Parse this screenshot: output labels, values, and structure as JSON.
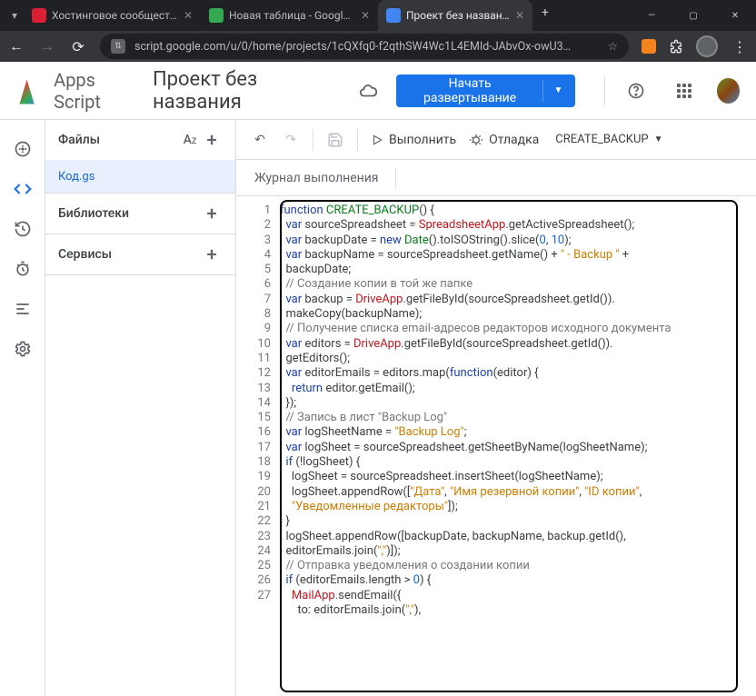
{
  "browser": {
    "tabs": [
      {
        "title": "Хостинговое сообщество",
        "favColor": "#db1f35"
      },
      {
        "title": "Новая таблица - Google Т",
        "favColor": "#34a853"
      },
      {
        "title": "Проект без названия - Ре",
        "favColor": "#4285f4"
      }
    ],
    "url": "script.google.com/u/0/home/projects/1cQXfq0-f2qthSW4Wc1L4EMId-JAbvOx-owU3…"
  },
  "header": {
    "appName": "Apps Script",
    "projectName": "Проект без названия",
    "deployLabel": "Начать развертывание"
  },
  "sidebar": {
    "files": {
      "label": "Файлы",
      "items": [
        "Код.gs"
      ]
    },
    "libraries": {
      "label": "Библиотеки"
    },
    "services": {
      "label": "Сервисы"
    }
  },
  "toolbar": {
    "runLabel": "Выполнить",
    "debugLabel": "Отладка",
    "fnName": "CREATE_BACKUP",
    "logLabel": "Журнал выполнения"
  },
  "code": {
    "lineNumbers": [
      "1",
      "2",
      "3",
      "4",
      "",
      "5",
      "6",
      "7",
      "",
      "8",
      "9",
      "10",
      "",
      "11",
      "12",
      "13",
      "14",
      "15",
      "16",
      "17",
      "18",
      "19",
      "20",
      "",
      "21",
      "22",
      "",
      "23",
      "24",
      "25",
      "26",
      "27"
    ],
    "lines": [
      [
        {
          "c": "kw",
          "t": "function"
        },
        {
          "c": "pun",
          "t": " "
        },
        {
          "c": "fn",
          "t": "CREATE_BACKUP"
        },
        {
          "c": "pun",
          "t": "() {"
        }
      ],
      [
        {
          "c": "pun",
          "t": "  "
        },
        {
          "c": "kw",
          "t": "var"
        },
        {
          "c": "pun",
          "t": " sourceSpreadsheet = "
        },
        {
          "c": "cls",
          "t": "SpreadsheetApp"
        },
        {
          "c": "pun",
          "t": ".getActiveSpreadsheet();"
        }
      ],
      [
        {
          "c": "pun",
          "t": "  "
        },
        {
          "c": "kw",
          "t": "var"
        },
        {
          "c": "pun",
          "t": " backupDate = "
        },
        {
          "c": "kw",
          "t": "new"
        },
        {
          "c": "pun",
          "t": " "
        },
        {
          "c": "fn",
          "t": "Date"
        },
        {
          "c": "pun",
          "t": "().toISOString().slice("
        },
        {
          "c": "num",
          "t": "0"
        },
        {
          "c": "pun",
          "t": ", "
        },
        {
          "c": "num",
          "t": "10"
        },
        {
          "c": "pun",
          "t": ");"
        }
      ],
      [
        {
          "c": "pun",
          "t": "  "
        },
        {
          "c": "kw",
          "t": "var"
        },
        {
          "c": "pun",
          "t": " backupName = sourceSpreadsheet.getName() + "
        },
        {
          "c": "str",
          "t": "\" - Backup \""
        },
        {
          "c": "pun",
          "t": " + "
        }
      ],
      [
        {
          "c": "pun",
          "t": "  backupDate;"
        }
      ],
      [
        {
          "c": "pun",
          "t": ""
        }
      ],
      [
        {
          "c": "pun",
          "t": "  "
        },
        {
          "c": "cmt",
          "t": "// Создание копии в той же папке"
        }
      ],
      [
        {
          "c": "pun",
          "t": "  "
        },
        {
          "c": "kw",
          "t": "var"
        },
        {
          "c": "pun",
          "t": " backup = "
        },
        {
          "c": "cls",
          "t": "DriveApp"
        },
        {
          "c": "pun",
          "t": ".getFileById(sourceSpreadsheet.getId())."
        }
      ],
      [
        {
          "c": "pun",
          "t": "  makeCopy(backupName);"
        }
      ],
      [
        {
          "c": "pun",
          "t": ""
        }
      ],
      [
        {
          "c": "pun",
          "t": "  "
        },
        {
          "c": "cmt",
          "t": "// Получение списка email-адресов редакторов исходного документа"
        }
      ],
      [
        {
          "c": "pun",
          "t": "  "
        },
        {
          "c": "kw",
          "t": "var"
        },
        {
          "c": "pun",
          "t": " editors = "
        },
        {
          "c": "cls",
          "t": "DriveApp"
        },
        {
          "c": "pun",
          "t": ".getFileById(sourceSpreadsheet.getId())."
        }
      ],
      [
        {
          "c": "pun",
          "t": "  getEditors();"
        }
      ],
      [
        {
          "c": "pun",
          "t": "  "
        },
        {
          "c": "kw",
          "t": "var"
        },
        {
          "c": "pun",
          "t": " editorEmails = editors.map("
        },
        {
          "c": "kw",
          "t": "function"
        },
        {
          "c": "pun",
          "t": "(editor) {"
        }
      ],
      [
        {
          "c": "pun",
          "t": "    "
        },
        {
          "c": "kw",
          "t": "return"
        },
        {
          "c": "pun",
          "t": " editor.getEmail();"
        }
      ],
      [
        {
          "c": "pun",
          "t": "  });"
        }
      ],
      [
        {
          "c": "pun",
          "t": ""
        }
      ],
      [
        {
          "c": "pun",
          "t": "  "
        },
        {
          "c": "cmt",
          "t": "// Запись в лист \"Backup Log\""
        }
      ],
      [
        {
          "c": "pun",
          "t": "  "
        },
        {
          "c": "kw",
          "t": "var"
        },
        {
          "c": "pun",
          "t": " logSheetName = "
        },
        {
          "c": "str",
          "t": "\"Backup Log\""
        },
        {
          "c": "pun",
          "t": ";"
        }
      ],
      [
        {
          "c": "pun",
          "t": "  "
        },
        {
          "c": "kw",
          "t": "var"
        },
        {
          "c": "pun",
          "t": " logSheet = sourceSpreadsheet.getSheetByName(logSheetName);"
        }
      ],
      [
        {
          "c": "pun",
          "t": "  "
        },
        {
          "c": "kw",
          "t": "if"
        },
        {
          "c": "pun",
          "t": " (!logSheet) {"
        }
      ],
      [
        {
          "c": "pun",
          "t": "    logSheet = sourceSpreadsheet.insertSheet(logSheetName);"
        }
      ],
      [
        {
          "c": "pun",
          "t": "    logSheet.appendRow(["
        },
        {
          "c": "str",
          "t": "\"Дата\""
        },
        {
          "c": "pun",
          "t": ", "
        },
        {
          "c": "str",
          "t": "\"Имя резервной копии\""
        },
        {
          "c": "pun",
          "t": ", "
        },
        {
          "c": "str",
          "t": "\"ID копии\""
        },
        {
          "c": "pun",
          "t": ", "
        }
      ],
      [
        {
          "c": "pun",
          "t": "    "
        },
        {
          "c": "str",
          "t": "\"Уведомленные редакторы\""
        },
        {
          "c": "pun",
          "t": "]);"
        }
      ],
      [
        {
          "c": "pun",
          "t": "  }"
        }
      ],
      [
        {
          "c": "pun",
          "t": "  logSheet.appendRow([backupDate, backupName, backup.getId(), "
        }
      ],
      [
        {
          "c": "pun",
          "t": "  editorEmails.join("
        },
        {
          "c": "str",
          "t": "\",\""
        },
        {
          "c": "pun",
          "t": ")]);"
        }
      ],
      [
        {
          "c": "pun",
          "t": ""
        }
      ],
      [
        {
          "c": "pun",
          "t": "  "
        },
        {
          "c": "cmt",
          "t": "// Отправка уведомления о создании копии"
        }
      ],
      [
        {
          "c": "pun",
          "t": "  "
        },
        {
          "c": "kw",
          "t": "if"
        },
        {
          "c": "pun",
          "t": " (editorEmails.length > "
        },
        {
          "c": "num",
          "t": "0"
        },
        {
          "c": "pun",
          "t": ") {"
        }
      ],
      [
        {
          "c": "pun",
          "t": "    "
        },
        {
          "c": "cls",
          "t": "MailApp"
        },
        {
          "c": "pun",
          "t": ".sendEmail({"
        }
      ],
      [
        {
          "c": "pun",
          "t": "      to: editorEmails.join("
        },
        {
          "c": "str",
          "t": "\",\""
        },
        {
          "c": "pun",
          "t": "),"
        }
      ]
    ],
    "highlightIndex": 16
  }
}
